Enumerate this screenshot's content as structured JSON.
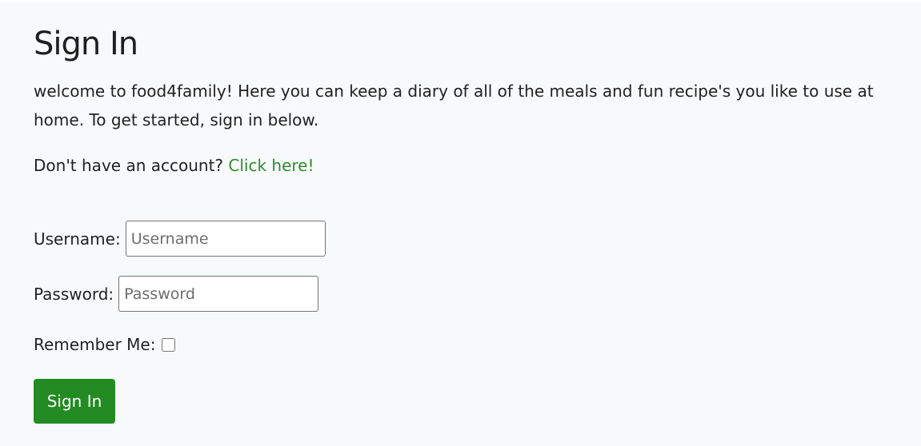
{
  "page": {
    "title": "Sign In",
    "intro": "welcome to food4family! Here you can keep a diary of all of the meals and fun recipe's you like to use at home. To get started, sign in below.",
    "signup_prompt": "Don't have an account?",
    "signup_link": "Click here!"
  },
  "form": {
    "username_label": "Username:",
    "username_placeholder": "Username",
    "username_value": "",
    "password_label": "Password:",
    "password_placeholder": "Password",
    "password_value": "",
    "remember_label": "Remember Me:",
    "remember_checked": false,
    "submit_label": "Sign In"
  },
  "colors": {
    "page_background": "#f8f9fa",
    "link": "#2e8b2e",
    "button_background": "#228b22",
    "button_text": "#ffffff"
  }
}
